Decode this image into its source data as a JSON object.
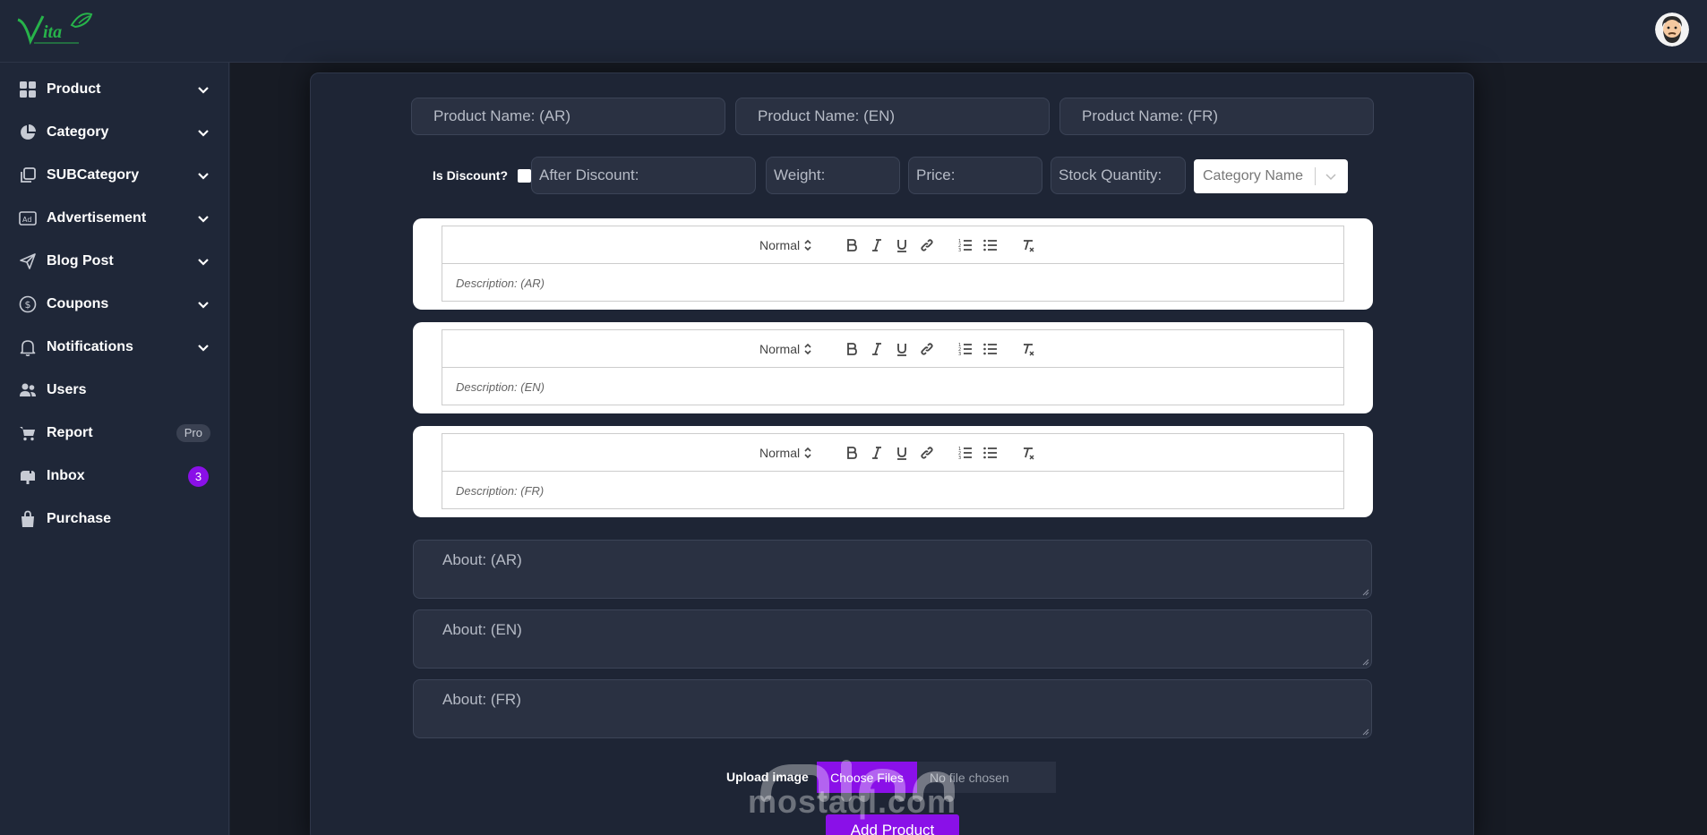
{
  "brand": {
    "logo_text": "Vita",
    "accent": "#8a10e8"
  },
  "sidebar": {
    "items": [
      {
        "label": "Product",
        "icon": "grid-icon",
        "chevron": true
      },
      {
        "label": "Category",
        "icon": "pie-chart-icon",
        "chevron": true
      },
      {
        "label": "SUBCategory",
        "icon": "copy-icon",
        "chevron": true
      },
      {
        "label": "Advertisement",
        "icon": "ad-icon",
        "chevron": true
      },
      {
        "label": "Blog Post",
        "icon": "send-icon",
        "chevron": true
      },
      {
        "label": "Coupons",
        "icon": "dollar-circle-icon",
        "chevron": true
      },
      {
        "label": "Notifications",
        "icon": "bell-icon",
        "chevron": true
      },
      {
        "label": "Users",
        "icon": "users-icon",
        "chevron": false
      },
      {
        "label": "Report",
        "icon": "cart-icon",
        "badge": "Pro"
      },
      {
        "label": "Inbox",
        "icon": "inbox-icon",
        "count": "3"
      },
      {
        "label": "Purchase",
        "icon": "bag-icon",
        "chevron": false
      }
    ]
  },
  "form": {
    "name_ar": "Product Name: (AR)",
    "name_en": "Product Name: (EN)",
    "name_fr": "Product Name: (FR)",
    "is_discount": "Is Discount?",
    "after_discount": "After Discount:",
    "weight": "Weight:",
    "price": "Price:",
    "stock": "Stock Quantity:",
    "category": "Category Name",
    "editor_format": "Normal",
    "desc_ar": "Description: (AR)",
    "desc_en": "Description: (EN)",
    "desc_fr": "Description: (FR)",
    "about_ar": "About: (AR)",
    "about_en": "About: (EN)",
    "about_fr": "About: (FR)",
    "upload_label": "Upload image",
    "choose_files": "Choose Files",
    "no_file": "No file chosen",
    "submit": "Add Product"
  },
  "watermark": {
    "text": "mostaql.com"
  }
}
